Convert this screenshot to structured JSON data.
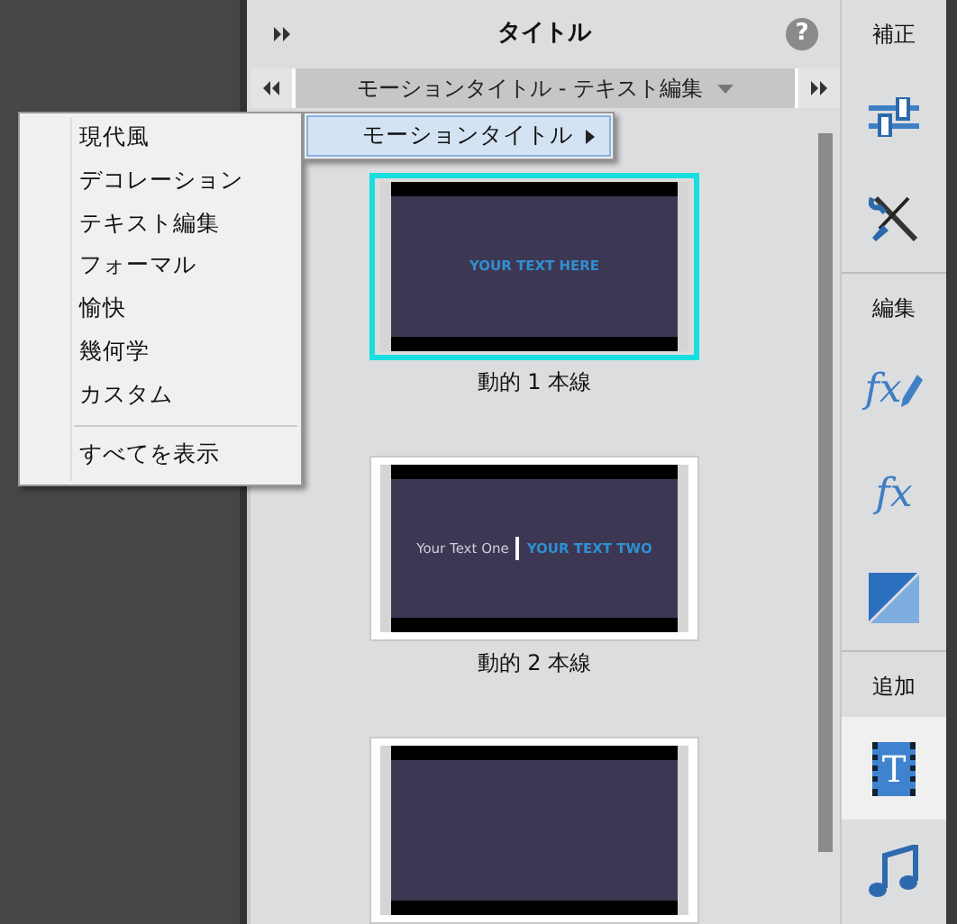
{
  "panel": {
    "title": "タイトル",
    "help": "?",
    "breadcrumb": "モーションタイトル - テキスト編集"
  },
  "thumbnails": [
    {
      "caption": "動的 1 本線",
      "selected": true,
      "kind": "one-line",
      "texts": [
        "YOUR TEXT HERE"
      ]
    },
    {
      "caption": "動的 2 本線",
      "selected": false,
      "kind": "two-line",
      "texts": [
        "Your Text One",
        "YOUR TEXT TWO"
      ]
    },
    {
      "selected": false,
      "kind": "blank"
    }
  ],
  "category_menu": {
    "items": [
      "現代風",
      "デコレーション",
      "テキスト編集",
      "フォーマル",
      "愉快",
      "幾何学",
      "カスタム"
    ],
    "footer": "すべてを表示"
  },
  "submenu": {
    "label": "モーションタイトル"
  },
  "sidebar": [
    {
      "label": "補正",
      "tools": [
        {
          "kind": "sliders",
          "selected": false
        },
        {
          "kind": "tools",
          "selected": false
        }
      ]
    },
    {
      "label": "編集",
      "tools": [
        {
          "kind": "fx-pen",
          "glyph": "fx",
          "selected": false
        },
        {
          "kind": "fx",
          "glyph": "fx",
          "selected": false
        },
        {
          "kind": "transition",
          "selected": false
        }
      ]
    },
    {
      "label": "追加",
      "tools": [
        {
          "kind": "title",
          "glyph": "T",
          "selected": true
        },
        {
          "kind": "music",
          "selected": false
        }
      ]
    }
  ]
}
